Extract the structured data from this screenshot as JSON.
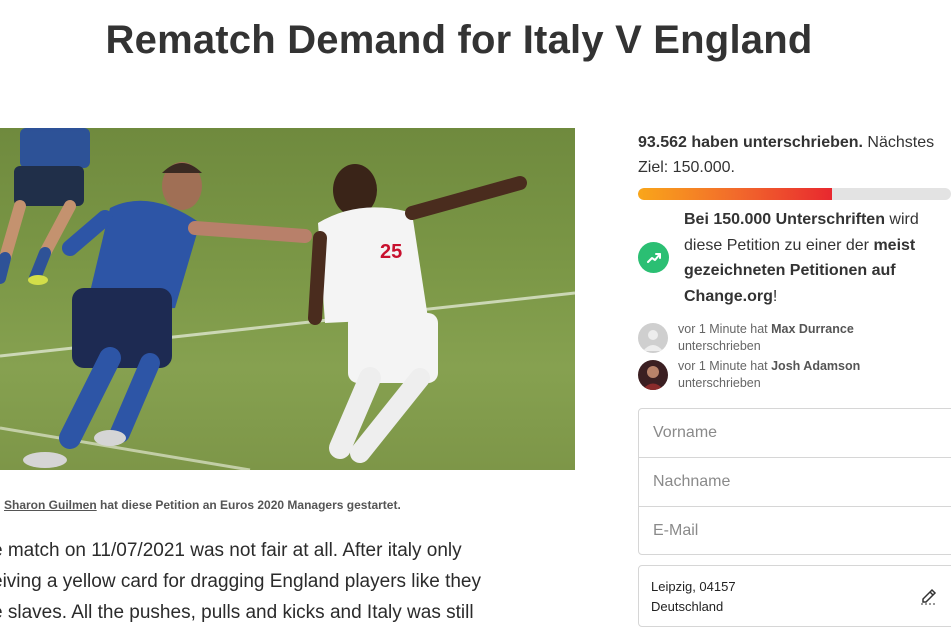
{
  "title": "Rematch Demand for Italy V England",
  "starter": {
    "author": "Sharon Guilmen",
    "text": " hat diese Petition an Euros 2020 Managers gestartet."
  },
  "body_lines": [
    "e match on 11/07/2021 was not fair at all. After italy only",
    "eiving a yellow card for dragging England players like they",
    "e slaves. All the pushes, pulls and kicks and Italy was still"
  ],
  "signatures": {
    "count_text": "93.562 haben unterschrieben.",
    "goal_text": " Nächstes Ziel: 150.000.",
    "progress": 0.62
  },
  "milestone": {
    "bold1": "Bei 150.000 Unterschriften",
    "text1": " wird diese Petition zu einer der ",
    "bold2": "meist gezeichneten Petitionen auf Change.org",
    "text2": "!"
  },
  "recent_signers": [
    {
      "prefix": "vor 1 Minute hat ",
      "name": "Max Durrance",
      "suffix": "unterschrieben"
    },
    {
      "prefix": "vor 1 Minute hat ",
      "name": "Josh Adamson",
      "suffix": "unterschrieben"
    }
  ],
  "form": {
    "first_name_placeholder": "Vorname",
    "last_name_placeholder": "Nachname",
    "email_placeholder": "E-Mail"
  },
  "location": {
    "line1": "Leipzig, 04157",
    "line2": "Deutschland"
  },
  "player_number": "25",
  "colors": {
    "success_green": "#2bbf73",
    "progress_start": "#f9a61a",
    "progress_end": "#e8282f"
  }
}
